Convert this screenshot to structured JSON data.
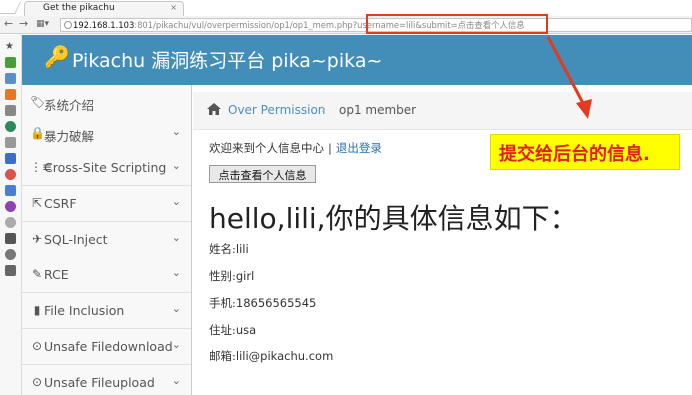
{
  "browser": {
    "tab_title": "Get the pikachu",
    "tab_close": "×",
    "url_host": "192.168.1.103",
    "url_rest": ":801/pikachu/vul/overpermission/op1/op1_mem.php?username=lili&submit=点击查看个人信息"
  },
  "header": {
    "title": "Pikachu 漏洞练习平台 pika~pika~"
  },
  "sidebar": {
    "items": [
      {
        "label": "系统介绍",
        "icon": "tag-icon",
        "glyph": "🏷"
      },
      {
        "label": "暴力破解",
        "icon": "lock-icon",
        "glyph": "🔒"
      },
      {
        "label": "Cross-Site Scripting",
        "icon": "filter-icon",
        "glyph": "⋮≡"
      },
      {
        "label": "CSRF",
        "icon": "share-icon",
        "glyph": "⇱"
      },
      {
        "label": "SQL-Inject",
        "icon": "plane-icon",
        "glyph": "✈"
      },
      {
        "label": "RCE",
        "icon": "pencil-icon",
        "glyph": "✎"
      },
      {
        "label": "File Inclusion",
        "icon": "file-icon",
        "glyph": "▮"
      },
      {
        "label": "Unsafe Filedownload",
        "icon": "download-icon",
        "glyph": "⊙"
      },
      {
        "label": "Unsafe Fileupload",
        "icon": "upload-icon",
        "glyph": "⊙"
      }
    ]
  },
  "breadcrumb": {
    "link": "Over Permission",
    "separator": "›",
    "current": "op1 member"
  },
  "main": {
    "welcome": "欢迎来到个人信息中心",
    "welcome_sep": "|",
    "logout": "退出登录",
    "view_button": "点击查看个人信息",
    "greeting": "hello,lili,你的具体信息如下：",
    "fields": [
      {
        "label": "姓名:",
        "value": "lili"
      },
      {
        "label": "性别:",
        "value": "girl"
      },
      {
        "label": "手机:",
        "value": "18656565545"
      },
      {
        "label": "住址:",
        "value": "usa"
      },
      {
        "label": "邮箱:",
        "value": "lili@pikachu.com"
      }
    ]
  },
  "annotation": {
    "text": "提交给后台的信息.",
    "color": "#e21f1f",
    "background": "#ffff00"
  },
  "colors": {
    "header_bg": "#438eb9",
    "link": "#4c8fbd"
  }
}
